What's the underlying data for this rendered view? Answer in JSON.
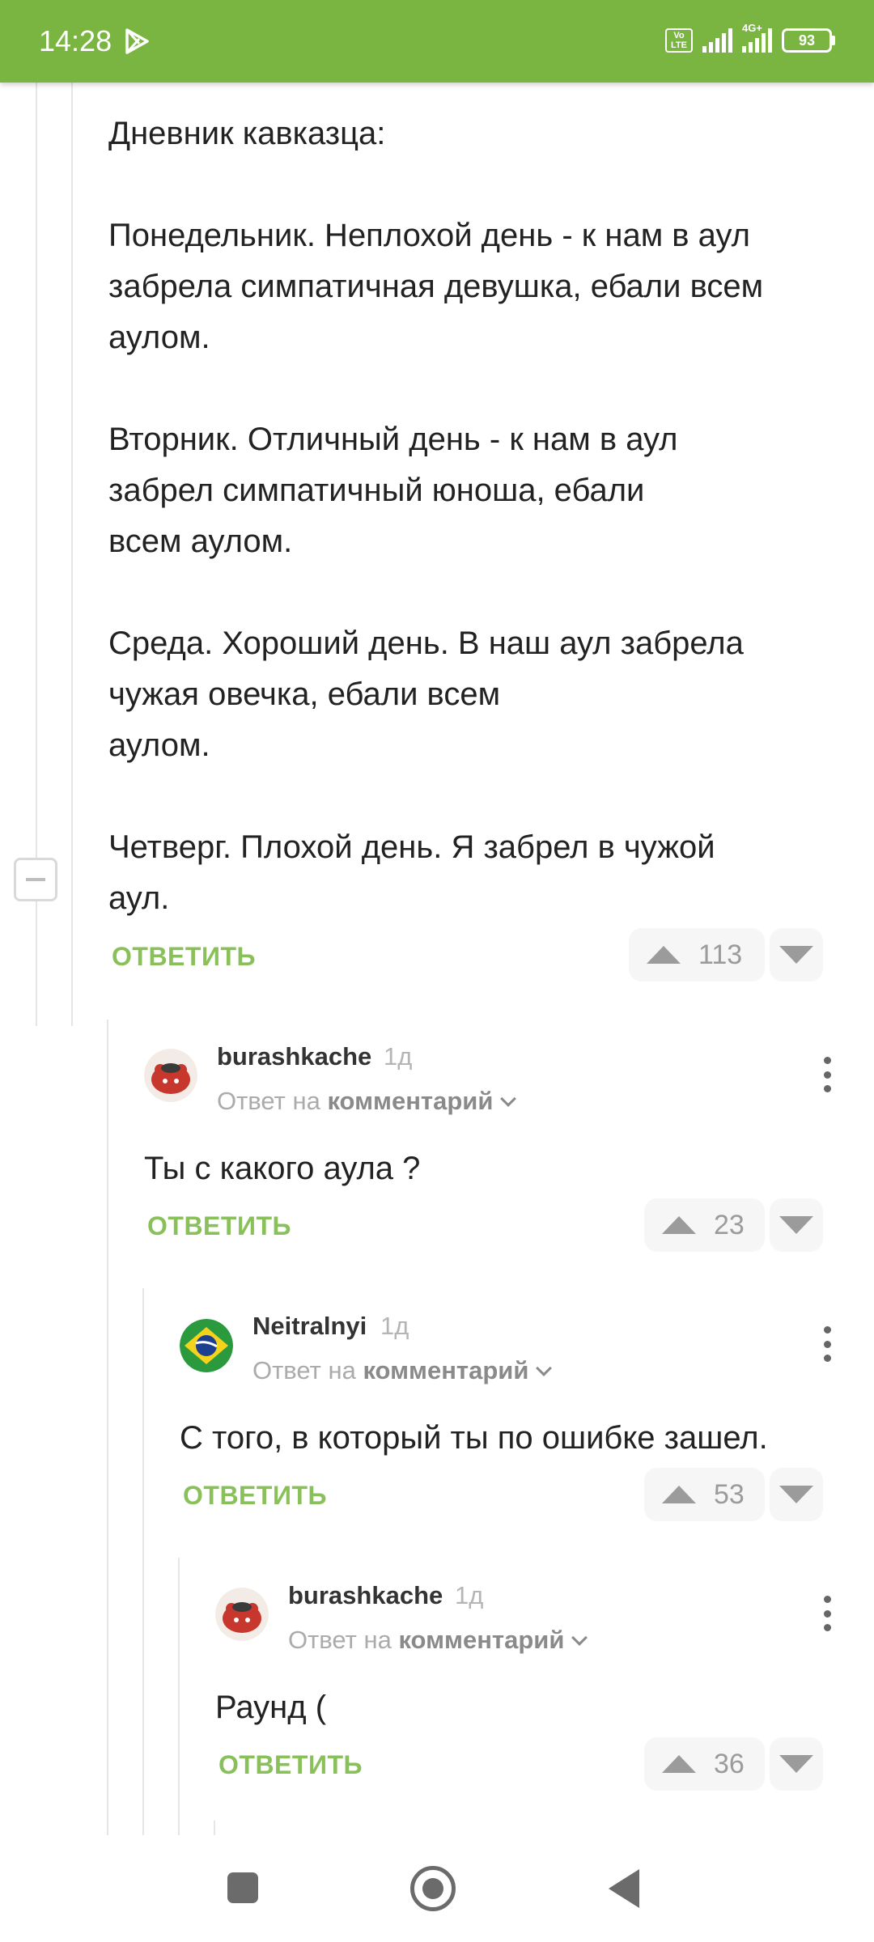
{
  "status_bar": {
    "time": "14:28",
    "volte": "Vo LTE",
    "network": "4G+",
    "battery": "93"
  },
  "post": {
    "lines": [
      "Дневник кавказца:",
      "",
      "Понедельник. Неплохой день - к нам в аул",
      "забрела симпатичная девушка, ебали всем",
      "аулом.",
      "",
      "Вторник. Отличный день - к нам в аул",
      "забрел симпатичный юноша, ебали",
      "всем аулом.",
      "",
      "Среда. Хороший день. В наш аул забрела",
      "чужая овечка, ебали всем",
      "аулом.",
      "",
      "Четверг. Плохой день. Я забрел в чужой",
      "аул."
    ],
    "reply_label": "ОТВЕТИТЬ",
    "votes": "113"
  },
  "comments": [
    {
      "author": "burashkache",
      "age": "1д",
      "reply_to_prefix": "Ответ на",
      "reply_to_target": "комментарий",
      "text": "Ты с какого аула ?",
      "reply_label": "ОТВЕТИТЬ",
      "votes": "23"
    },
    {
      "author": "Neitralnyi",
      "age": "1д",
      "reply_to_prefix": "Ответ на",
      "reply_to_target": "комментарий",
      "text": "С того, в который ты по ошибке зашел.",
      "reply_label": "ОТВЕТИТЬ",
      "votes": "53"
    },
    {
      "author": "burashkache",
      "age": "1д",
      "reply_to_prefix": "Ответ на",
      "reply_to_target": "комментарий",
      "text": "Раунд (",
      "reply_label": "ОТВЕТИТЬ",
      "votes": "36"
    }
  ],
  "colors": {
    "accent": "#7bb541",
    "reply": "#8ac05a",
    "vote_gray": "#9b9b9b"
  },
  "icons": {
    "status": [
      "play-store-icon",
      "signal-icon",
      "battery-icon"
    ],
    "nav": [
      "recent-apps-icon",
      "home-icon",
      "back-icon"
    ]
  }
}
